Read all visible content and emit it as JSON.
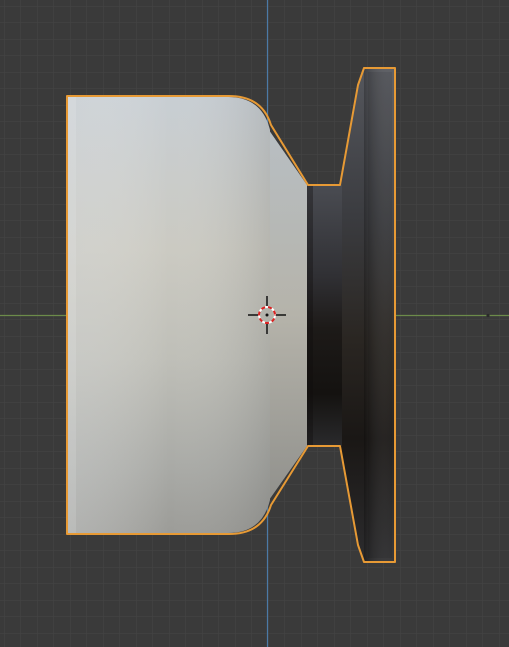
{
  "viewport": {
    "background": "#3a3a3a",
    "grid_minor_color": "#444444",
    "grid_major_color": "#4b4b4b",
    "axis_x_color": "#6f8a4f",
    "axis_z_color": "#4f7ea8",
    "selection_outline_color": "#e79a35"
  },
  "objects": [
    {
      "name": "selected-mesh",
      "parts": [
        "cylinder-body",
        "neck",
        "flange"
      ],
      "selected": true
    }
  ],
  "cursor": {
    "icon": "3d-cursor-crosshair-icon"
  }
}
